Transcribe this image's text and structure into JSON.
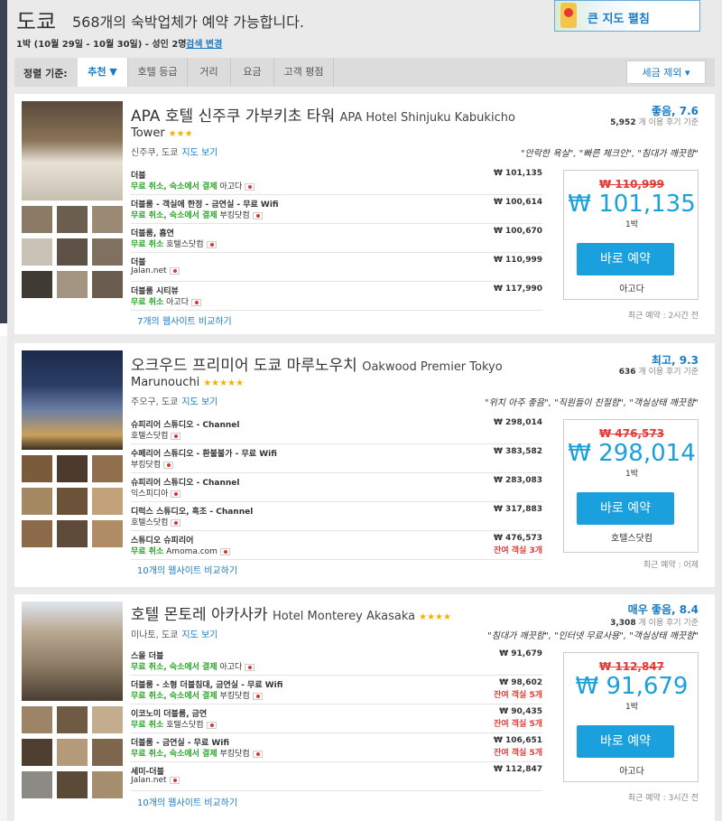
{
  "header": {
    "city": "도쿄",
    "count_text": "568개의 숙박업체가 예약 가능합니다.",
    "dates": "1박 (10월 29일 - 10월 30일) - 성인 2명",
    "change_link": "검색 변경",
    "map_button": "큰 지도 펼침"
  },
  "sortbar": {
    "label": "정렬 기준:",
    "tabs": [
      "추천 ▼",
      "호텔 등급",
      "거리",
      "요금",
      "고객 평점"
    ],
    "tax_toggle": "세금 제외 ▾"
  },
  "hotels": [
    {
      "name_ko": "APA 호텔 신주쿠 가부키초 타워",
      "name_en_1": "APA Hotel Shinjuku Kabukicho",
      "name_en_2": "Tower",
      "stars": "★★★",
      "score": "좋음, 7.6",
      "reviews_count": "5,952",
      "reviews_suffix": "개 이용 후기 기준",
      "location": "신주쿠, 도쿄",
      "map_link": "지도 보기",
      "quote": "\"안락한 욕실\", \"빠른 체크인\", \"침대가 깨끗함\"",
      "deals": [
        {
          "room": "더블",
          "free": "무료 취소, 숙소에서 결제",
          "provider": "아고다",
          "price": "₩ 101,135",
          "left": ""
        },
        {
          "room": "더블룸 - 객실에 한정 - 금연실 - 무료 Wifi",
          "free": "무료 취소, 숙소에서 결제",
          "provider": "부킹닷컴",
          "price": "₩ 100,614",
          "left": ""
        },
        {
          "room": "더블룸, 흡연",
          "free": "무료 취소",
          "provider": "호텔스닷컴",
          "price": "₩ 100,670",
          "left": ""
        },
        {
          "room": "더블",
          "free": "",
          "provider": "Jalan.net",
          "price": "₩ 110,999",
          "left": ""
        },
        {
          "room": "더블룸 시티뷰",
          "free": "무료 취소",
          "provider": "아고다",
          "price": "₩ 117,990",
          "left": ""
        }
      ],
      "compare": "7개의 웹사이트 비교하기",
      "strike_price": "₩ 110,999",
      "big_price": "₩ 101,135",
      "per": "1박",
      "button": "바로 예약",
      "button_provider": "아고다",
      "recent": "최근 예약 : 2시간 전"
    },
    {
      "name_ko": "오크우드 프리미어 도쿄 마루노우치",
      "name_en_1": "Oakwood Premier Tokyo",
      "name_en_2": "Marunouchi",
      "stars": "★★★★★",
      "score": "최고, 9.3",
      "reviews_count": "636",
      "reviews_suffix": "개 이용 후기 기준",
      "location": "주오구, 도쿄",
      "map_link": "지도 보기",
      "quote": "\"위치 아주 좋음\", \"직원들이 친절함\", \"객실상태 깨끗함\"",
      "deals": [
        {
          "room": "슈피리어 스튜디오 - Channel",
          "free": "",
          "provider": "호텔스닷컴",
          "price": "₩ 298,014",
          "left": ""
        },
        {
          "room": "수페리어 스튜디오 - 환불불가 - 무료 Wifi",
          "free": "",
          "provider": "부킹닷컴",
          "price": "₩ 383,582",
          "left": ""
        },
        {
          "room": "슈피리어 스튜디오 - Channel",
          "free": "",
          "provider": "익스피디아",
          "price": "₩ 283,083",
          "left": ""
        },
        {
          "room": "디럭스 스튜디오, 흑조 - Channel",
          "free": "",
          "provider": "호텔스닷컴",
          "price": "₩ 317,883",
          "left": ""
        },
        {
          "room": "스튜디오 슈피리어",
          "free": "무료 취소",
          "provider": "Amoma.com",
          "price": "₩ 476,573",
          "left": "잔여 객실 3개"
        }
      ],
      "compare": "10개의 웹사이트 비교하기",
      "strike_price": "₩ 476,573",
      "big_price": "₩ 298,014",
      "per": "1박",
      "button": "바로 예약",
      "button_provider": "호텔스닷컴",
      "recent": "최근 예약 : 어제"
    },
    {
      "name_ko": "호텔 몬토레 아카사카",
      "name_en_1": "Hotel Monterey Akasaka",
      "name_en_2": "",
      "stars": "★★★★",
      "score": "매우 좋음, 8.4",
      "reviews_count": "3,308",
      "reviews_suffix": "개 이용 후기 기준",
      "location": "미나토, 도쿄",
      "map_link": "지도 보기",
      "quote": "\"침대가 깨끗함\", \"인터넷 무료사용\", \"객실상태 깨끗함\"",
      "deals": [
        {
          "room": "스몰 더블",
          "free": "무료 취소, 숙소에서 결제",
          "provider": "아고다",
          "price": "₩ 91,679",
          "left": ""
        },
        {
          "room": "더블룸 - 소형 더블침대, 금연실 - 무료 Wifi",
          "free": "무료 취소, 숙소에서 결제",
          "provider": "부킹닷컴",
          "price": "₩ 98,602",
          "left": "잔여 객실 5개"
        },
        {
          "room": "이코노미 더블룸, 금연",
          "free": "무료 취소",
          "provider": "호텔스닷컴",
          "price": "₩ 90,435",
          "left": "잔여 객실 5개"
        },
        {
          "room": "더블룸 - 금연실 - 무료 Wifi",
          "free": "무료 취소, 숙소에서 결제",
          "provider": "부킹닷컴",
          "price": "₩ 106,651",
          "left": "잔여 객실 5개"
        },
        {
          "room": "세미-더블",
          "free": "",
          "provider": "Jalan.net",
          "price": "₩ 112,847",
          "left": ""
        }
      ],
      "compare": "10개의 웹사이트 비교하기",
      "strike_price": "₩ 112,847",
      "big_price": "₩ 91,679",
      "per": "1박",
      "button": "바로 예약",
      "button_provider": "아고다",
      "recent": "최근 예약 : 3시간 전"
    }
  ]
}
